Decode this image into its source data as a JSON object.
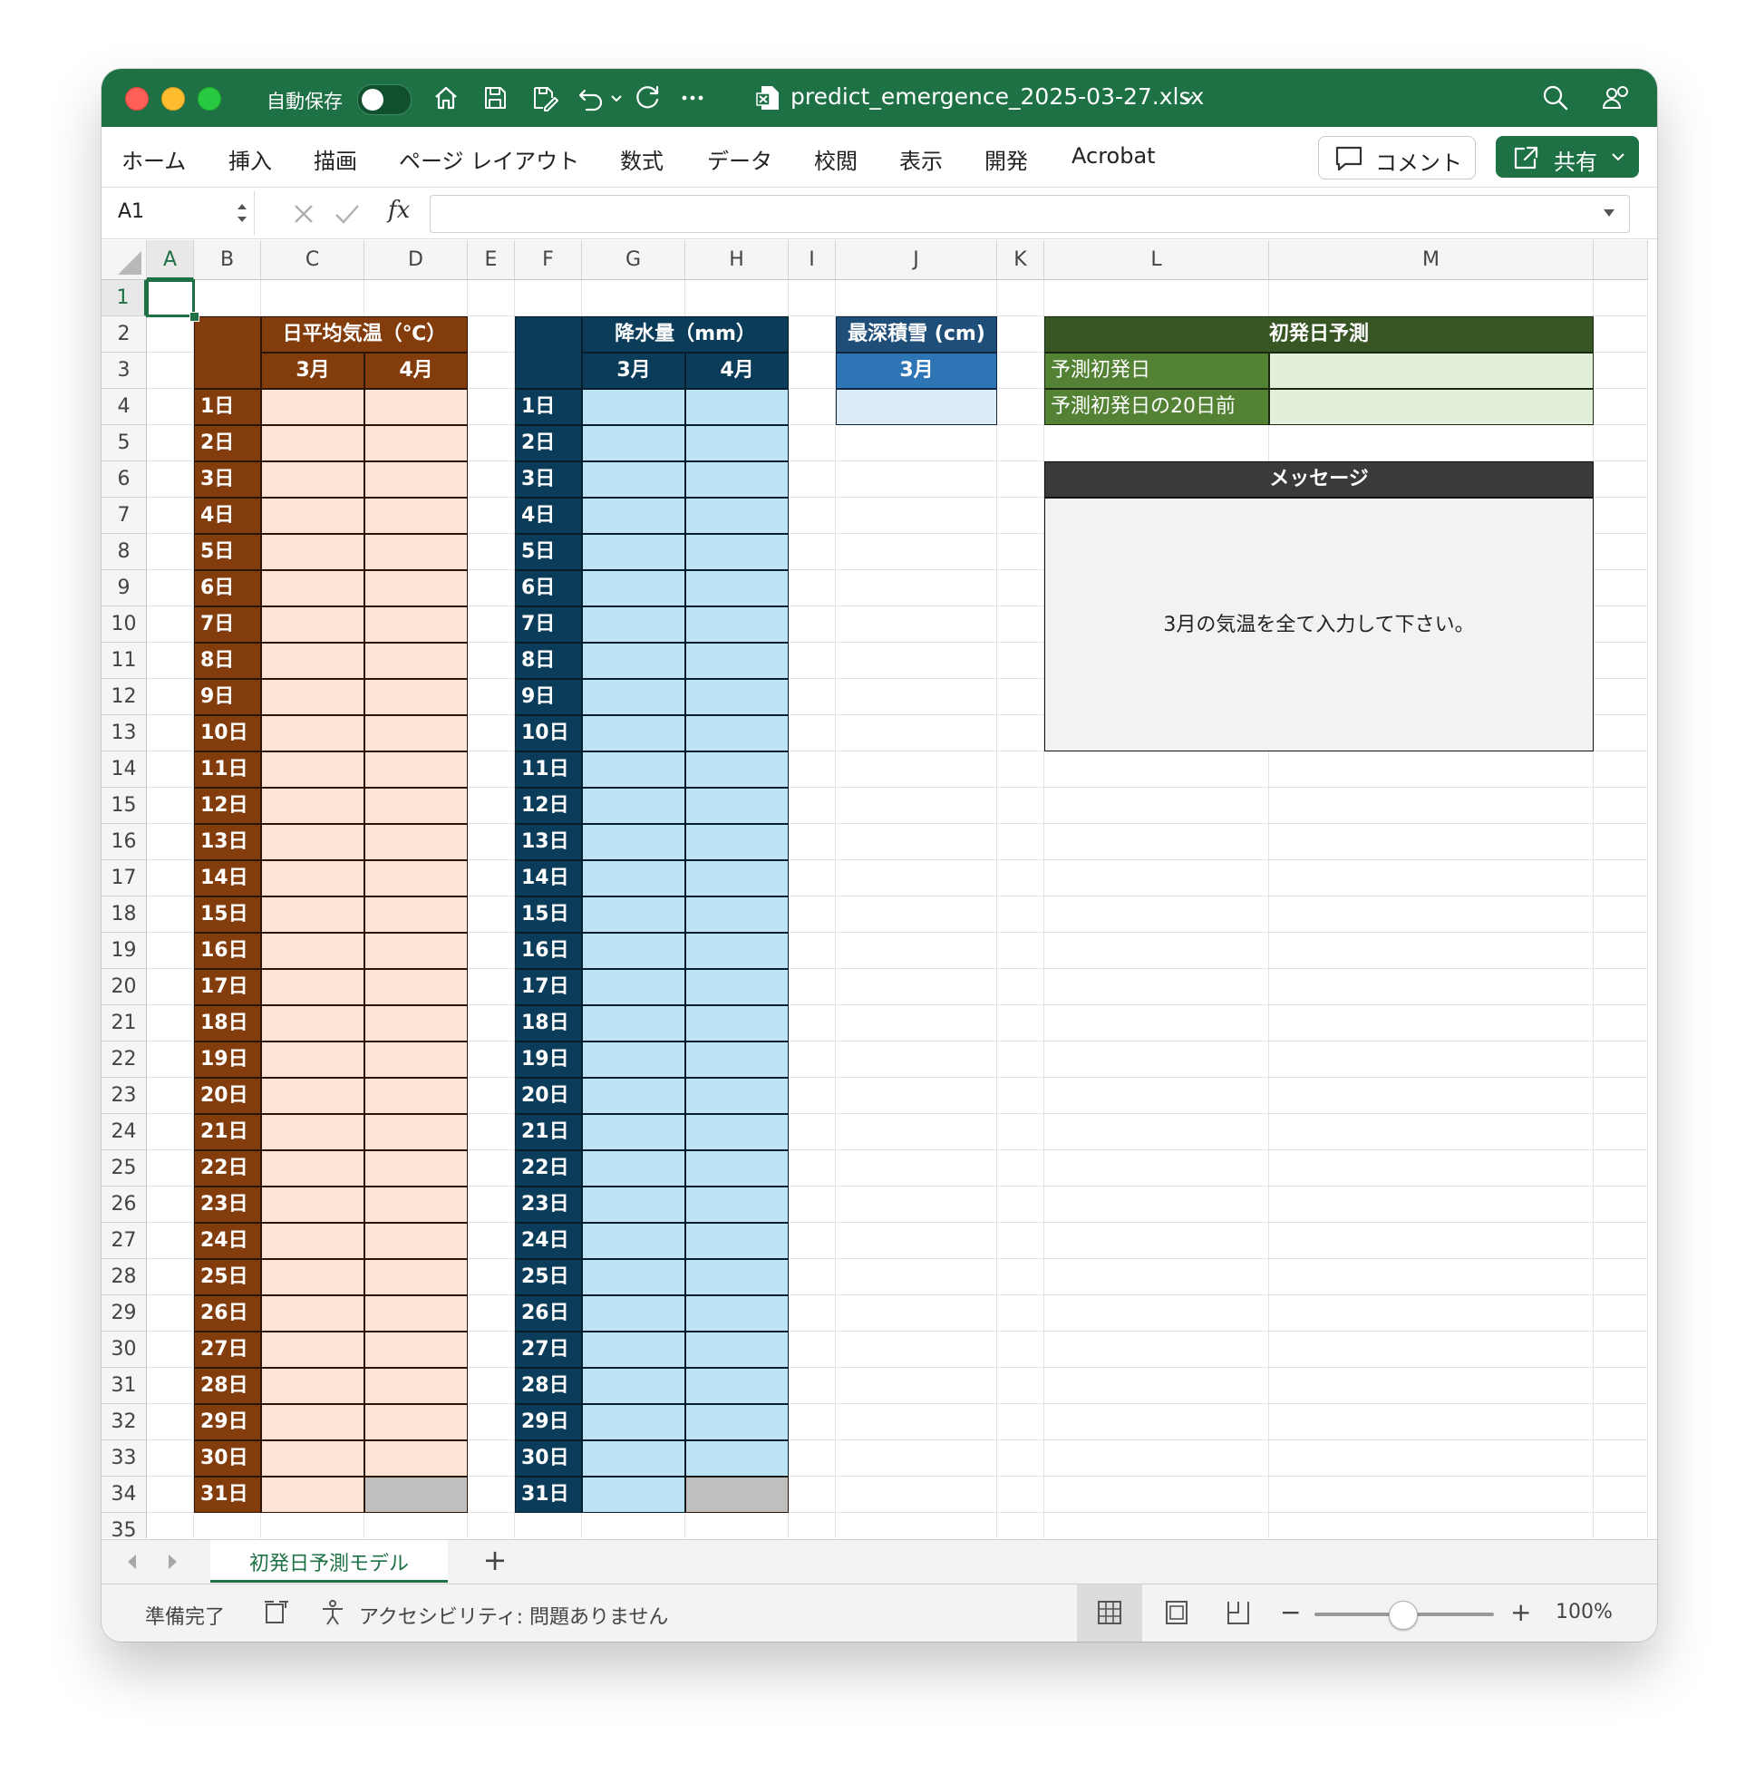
{
  "app": {
    "autosave_label": "自動保存",
    "file_name": "predict_emergence_2025-03-27.xlsx",
    "colors": {
      "brand": "#1e7145"
    }
  },
  "ribbon": {
    "tabs": [
      "ホーム",
      "挿入",
      "描画",
      "ページ レイアウト",
      "数式",
      "データ",
      "校閲",
      "表示",
      "開発",
      "Acrobat"
    ],
    "comment_label": "コメント",
    "share_label": "共有"
  },
  "formula_bar": {
    "name_box": "A1",
    "fx_label": "fx",
    "formula": ""
  },
  "columns": [
    "A",
    "B",
    "C",
    "D",
    "E",
    "F",
    "G",
    "H",
    "I",
    "J",
    "K",
    "L",
    "M"
  ],
  "selected_cell": "A1",
  "rows": [
    "1",
    "2",
    "3",
    "4",
    "5",
    "6",
    "7",
    "8",
    "9",
    "10",
    "11",
    "12",
    "13",
    "14",
    "15",
    "16",
    "17",
    "18",
    "19",
    "20",
    "21",
    "22",
    "23",
    "24",
    "25",
    "26",
    "27",
    "28",
    "29",
    "30",
    "31",
    "32",
    "33",
    "34",
    "35"
  ],
  "days": [
    "1日",
    "2日",
    "3日",
    "4日",
    "5日",
    "6日",
    "7日",
    "8日",
    "9日",
    "10日",
    "11日",
    "12日",
    "13日",
    "14日",
    "15日",
    "16日",
    "17日",
    "18日",
    "19日",
    "20日",
    "21日",
    "22日",
    "23日",
    "24日",
    "25日",
    "26日",
    "27日",
    "28日",
    "29日",
    "30日",
    "31日"
  ],
  "temp_table": {
    "title": "日平均気温（℃）",
    "march": "3月",
    "april": "4月"
  },
  "rain_table": {
    "title": "降水量（mm）",
    "march": "3月",
    "april": "4月"
  },
  "snow_table": {
    "title": "最深積雪 (cm)",
    "march": "3月",
    "value": ""
  },
  "prediction": {
    "title": "初発日予測",
    "row1_label": "予測初発日",
    "row1_value": "",
    "row2_label": "予測初発日の20日前",
    "row2_value": ""
  },
  "message": {
    "title": "メッセージ",
    "text": "3月の気温を全て入力して下さい。"
  },
  "sheets": {
    "active": "初発日予測モデル",
    "add": "+"
  },
  "status": {
    "ready": "準備完了",
    "accessibility": "アクセシビリティ: 問題ありません",
    "zoom": "100%",
    "zoom_minus": "−",
    "zoom_plus": "+"
  }
}
